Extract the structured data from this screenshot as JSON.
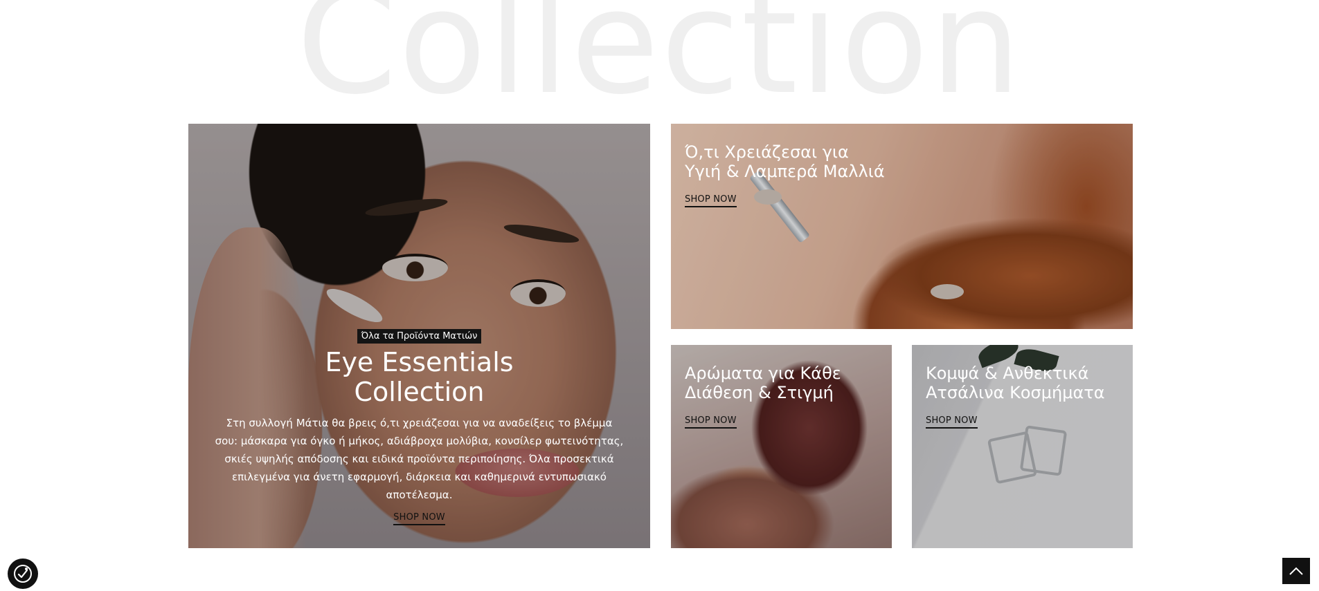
{
  "background_title": "Collection",
  "main_card": {
    "badge": "Όλα τα Προϊόντα Ματιών",
    "title_line1": "Eye Essentials",
    "title_line2": "Collection",
    "description": "Στη συλλογή Μάτια θα βρεις ό,τι χρειάζεσαι για να αναδείξεις το βλέμμα σου: μάσκαρα για όγκο ή μήκος, αδιάβροχα μολύβια, κονσίλερ φωτεινότητας, σκιές υψηλής απόδοσης και ειδικά προϊόντα περιποίησης. Όλα προσεκτικά επιλεγμένα για άνετη εφαρμογή, διάρκεια και καθημερινά εντυπωσιακό αποτέλεσμα.",
    "shop_label": "SHOP NOW"
  },
  "hair_card": {
    "heading_line1": "Ό,τι Χρειάζεσαι για",
    "heading_line2": "Υγιή & Λαμπερά Μαλλιά",
    "shop_label": "SHOP NOW"
  },
  "perfume_card": {
    "heading_line1": "Αρώματα για Κάθε",
    "heading_line2": "Διάθεση & Στιγμή",
    "shop_label": "SHOP NOW"
  },
  "jewelry_card": {
    "heading_line1": "Κομψά & Ανθεκτικά",
    "heading_line2": "Ατσάλινα Κοσμήματα",
    "shop_label": "SHOP NOW"
  },
  "icons": {
    "accessibility": "accessibility-icon",
    "back_to_top": "chevron-up-icon"
  },
  "colors": {
    "background_title": "#efefef",
    "badge_bg": "#141414",
    "button_bg": "#111111",
    "text_light": "#ffffff"
  }
}
